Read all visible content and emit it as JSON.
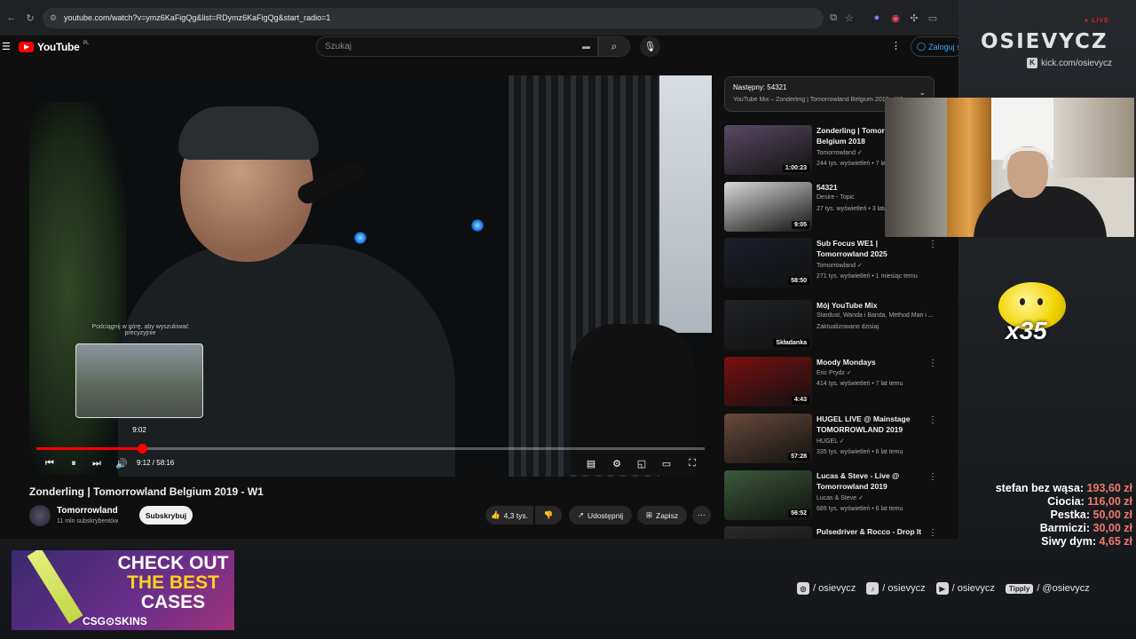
{
  "browser": {
    "url": "youtube.com/watch?v=ymz6KaFigQg&list=RDymz6KaFigQg&start_radio=1"
  },
  "youtube": {
    "logo_text": "YouTube",
    "region": "PL",
    "search_placeholder": "Szukaj",
    "login_label": "Zaloguj s"
  },
  "player": {
    "scrub_hint": "Podciągnij w górę, aby wyszukiwać precyzyjnie",
    "preview_time": "9:02",
    "time_display": "9:12 / 58:16",
    "progress": 0.158
  },
  "video": {
    "title": "Zonderling | Tomorrowland Belgium 2019 - W1",
    "channel": "Tomorrowland",
    "subs": "11 mln subskrybentów",
    "subscribe_label": "Subskrybuj",
    "likes": "4,3 tys.",
    "share_label": "Udostępnij",
    "save_label": "Zapisz"
  },
  "queue": {
    "next_label": "Następny: 54321",
    "subtitle": "YouTube Mix – Zonderling | Tomorrowland Belgium 2019 - W1"
  },
  "recommendations": [
    {
      "title": "Zonderling | Tomorrowland Belgium 2018",
      "channel": "Tomorrowland",
      "verified": true,
      "meta": "244 tys. wyświetleń • 7 lat temu",
      "duration": "1:00:23",
      "thumb_color": "#5a4a62"
    },
    {
      "title": "54321",
      "channel": "Desire - Topic",
      "verified": false,
      "meta": "27 tys. wyświetleń • 3 lata temu",
      "duration": "9:05",
      "thumb_color": "#d9d9d9"
    },
    {
      "title": "Sub Focus WE1 | Tomorrowland 2025",
      "channel": "Tomorrowland",
      "verified": true,
      "meta": "271 tys. wyświetleń • 1 miesiąc temu",
      "duration": "58:50",
      "thumb_color": "#1a1f2a"
    },
    {
      "title": "Mój YouTube Mix",
      "channel": "Stardust, Wanda i Banda, Method Man i ...",
      "verified": false,
      "meta": "Zaktualizowano dzisiaj",
      "duration": "Składanka",
      "thumb_color": "#202226"
    },
    {
      "title": "Moody Mondays",
      "channel": "Eric Prydz",
      "verified": true,
      "meta": "414 tys. wyświetleń • 7 lat temu",
      "duration": "4:43",
      "thumb_color": "#7a1010"
    },
    {
      "title": "HUGEL LIVE @ Mainstage TOMORROWLAND 2019",
      "channel": "HUGEL",
      "verified": true,
      "meta": "335 tys. wyświetleń • 6 lat temu",
      "duration": "57:28",
      "thumb_color": "#6a4a3a"
    },
    {
      "title": "Lucas & Steve - Live @ Tomorrowland 2019 (Weekend...",
      "channel": "Lucas & Steve",
      "verified": true,
      "meta": "689 tys. wyświetleń • 6 lat temu",
      "duration": "56:52",
      "thumb_color": "#3a5a3a"
    },
    {
      "title": "Pulsedriver & Rocco - Drop It",
      "channel": "",
      "verified": false,
      "meta": "",
      "duration": "",
      "thumb_color": "#2a2a2a"
    }
  ],
  "overlay": {
    "brand": "OSIEVYCZ",
    "live": "● LIVE",
    "kick": "kick.com/osievycz",
    "emote_count": "x35",
    "donations": [
      {
        "name": "stefan bez wąsa:",
        "amount": "193,60 zł"
      },
      {
        "name": "Ciocia:",
        "amount": "116,00 zł"
      },
      {
        "name": "Pestka:",
        "amount": "50,00 zł"
      },
      {
        "name": "Barmiczi:",
        "amount": "30,00 zł"
      },
      {
        "name": "Siwy dym:",
        "amount": "4,65 zł"
      }
    ],
    "socials": [
      {
        "icon": "instagram-icon",
        "glyph": "◎",
        "handle": "/ osievycz"
      },
      {
        "icon": "tiktok-icon",
        "glyph": "♪",
        "handle": "/ osievycz"
      },
      {
        "icon": "youtube-icon",
        "glyph": "▶",
        "handle": "/ osievycz"
      },
      {
        "icon": "tipply-icon",
        "glyph": "Tipply",
        "handle": "/ @osievycz"
      }
    ],
    "ad": {
      "line1": "CHECK OUT",
      "line2": "THE BEST",
      "line3": "CASES",
      "brand": "CSG⊙SKINS"
    }
  }
}
